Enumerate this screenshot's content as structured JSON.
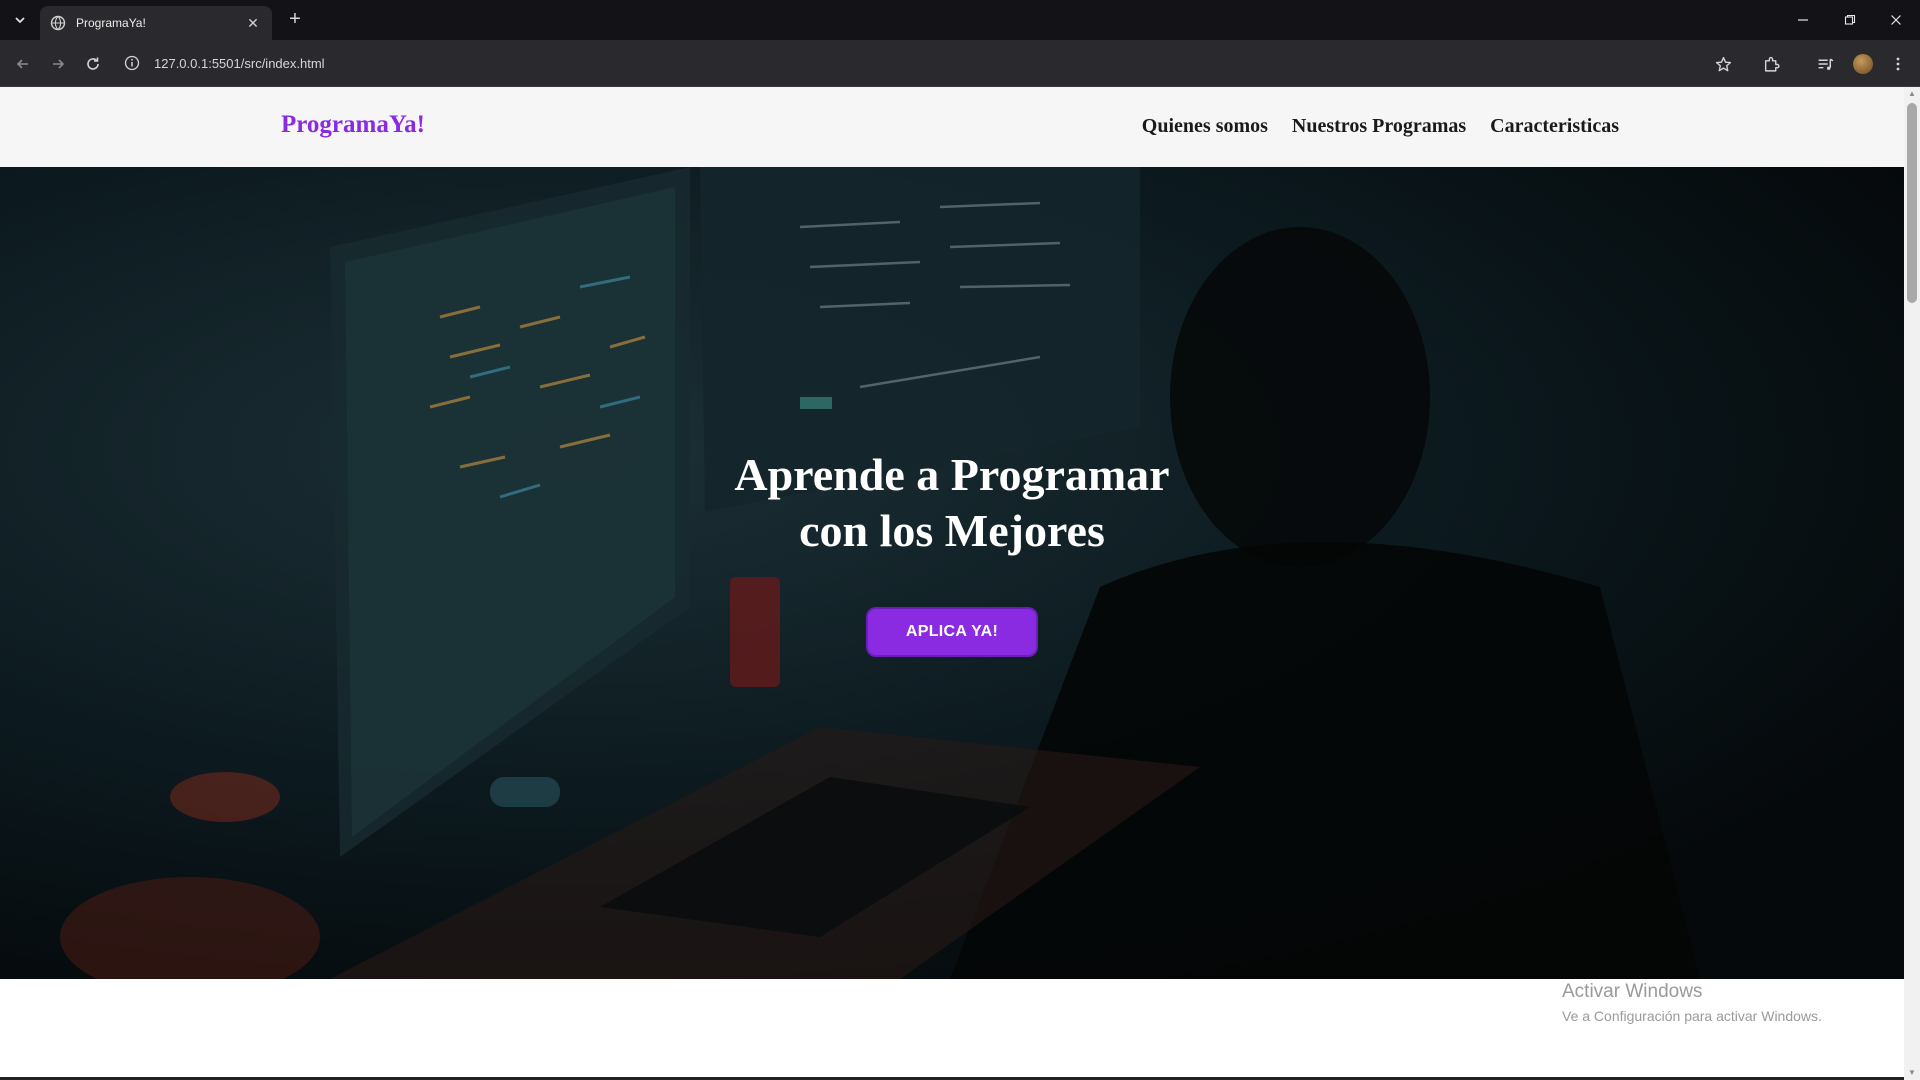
{
  "browser": {
    "tab_title": "ProgramaYa!",
    "tab_close": "✕",
    "new_tab": "+",
    "url": "127.0.0.1:5501/src/index.html"
  },
  "site": {
    "logo": "ProgramaYa!",
    "nav": [
      "Quienes somos",
      "Nuestros Programas",
      "Caracteristicas"
    ],
    "accent_color": "#8a2be2"
  },
  "hero": {
    "title_line1": "Aprende a Programar",
    "title_line2": "con los Mejores",
    "cta": "APLICA YA!"
  },
  "watermark": {
    "line1": "Activar Windows",
    "line2": "Ve a Configuración para activar Windows."
  }
}
